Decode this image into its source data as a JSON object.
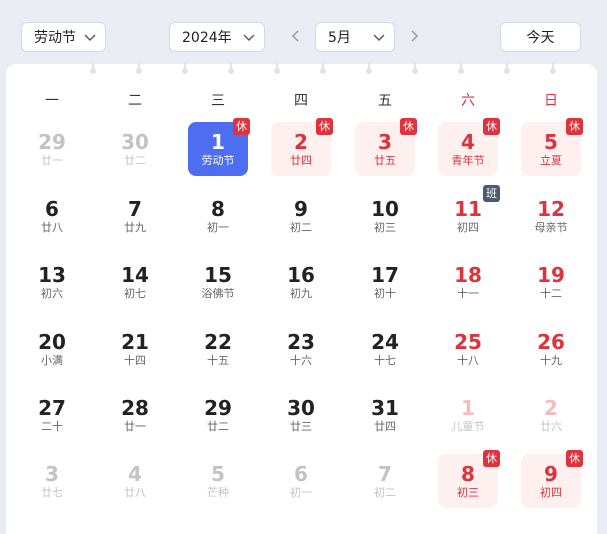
{
  "toolbar": {
    "holiday_select": "劳动节",
    "year_select": "2024年",
    "month_select": "5月",
    "today_label": "今天"
  },
  "weekdays": [
    "一",
    "二",
    "三",
    "四",
    "五",
    "六",
    "日"
  ],
  "badges": {
    "rest": "休",
    "work": "班"
  },
  "colors": {
    "accent": "#4e6ef2",
    "holiday_red": "#e0323c",
    "holiday_bg": "#fdf0ef",
    "work_badge": "#4e5a6e"
  },
  "rows": [
    [
      {
        "day": "29",
        "lunar": "廿一",
        "other": true
      },
      {
        "day": "30",
        "lunar": "廿二",
        "other": true
      },
      {
        "day": "1",
        "lunar": "劳动节",
        "selected": true,
        "badge": "rest"
      },
      {
        "day": "2",
        "lunar": "廿四",
        "holiday": true,
        "badge": "rest"
      },
      {
        "day": "3",
        "lunar": "廿五",
        "holiday": true,
        "badge": "rest"
      },
      {
        "day": "4",
        "lunar": "青年节",
        "holiday": true,
        "badge": "rest"
      },
      {
        "day": "5",
        "lunar": "立夏",
        "holiday": true,
        "badge": "rest"
      }
    ],
    [
      {
        "day": "6",
        "lunar": "廿八"
      },
      {
        "day": "7",
        "lunar": "廿九"
      },
      {
        "day": "8",
        "lunar": "初一"
      },
      {
        "day": "9",
        "lunar": "初二"
      },
      {
        "day": "10",
        "lunar": "初三"
      },
      {
        "day": "11",
        "lunar": "初四",
        "badge": "work"
      },
      {
        "day": "12",
        "lunar": "母亲节",
        "weekend": true
      }
    ],
    [
      {
        "day": "13",
        "lunar": "初六"
      },
      {
        "day": "14",
        "lunar": "初七"
      },
      {
        "day": "15",
        "lunar": "浴佛节"
      },
      {
        "day": "16",
        "lunar": "初九"
      },
      {
        "day": "17",
        "lunar": "初十"
      },
      {
        "day": "18",
        "lunar": "十一",
        "weekend": true
      },
      {
        "day": "19",
        "lunar": "十二",
        "weekend": true
      }
    ],
    [
      {
        "day": "20",
        "lunar": "小满"
      },
      {
        "day": "21",
        "lunar": "十四"
      },
      {
        "day": "22",
        "lunar": "十五"
      },
      {
        "day": "23",
        "lunar": "十六"
      },
      {
        "day": "24",
        "lunar": "十七"
      },
      {
        "day": "25",
        "lunar": "十八",
        "weekend": true
      },
      {
        "day": "26",
        "lunar": "十九",
        "weekend": true
      }
    ],
    [
      {
        "day": "27",
        "lunar": "二十"
      },
      {
        "day": "28",
        "lunar": "廿一"
      },
      {
        "day": "29",
        "lunar": "廿二"
      },
      {
        "day": "30",
        "lunar": "廿三"
      },
      {
        "day": "31",
        "lunar": "廿四"
      },
      {
        "day": "1",
        "lunar": "儿童节",
        "other": true,
        "weekend": true
      },
      {
        "day": "2",
        "lunar": "廿六",
        "other": true,
        "weekend": true
      }
    ],
    [
      {
        "day": "3",
        "lunar": "廿七",
        "other": true
      },
      {
        "day": "4",
        "lunar": "廿八",
        "other": true
      },
      {
        "day": "5",
        "lunar": "芒种",
        "other": true
      },
      {
        "day": "6",
        "lunar": "初一",
        "other": true
      },
      {
        "day": "7",
        "lunar": "初二",
        "other": true
      },
      {
        "day": "8",
        "lunar": "初三",
        "holiday": true,
        "badge": "rest"
      },
      {
        "day": "9",
        "lunar": "初四",
        "holiday": true,
        "badge": "rest"
      }
    ]
  ]
}
